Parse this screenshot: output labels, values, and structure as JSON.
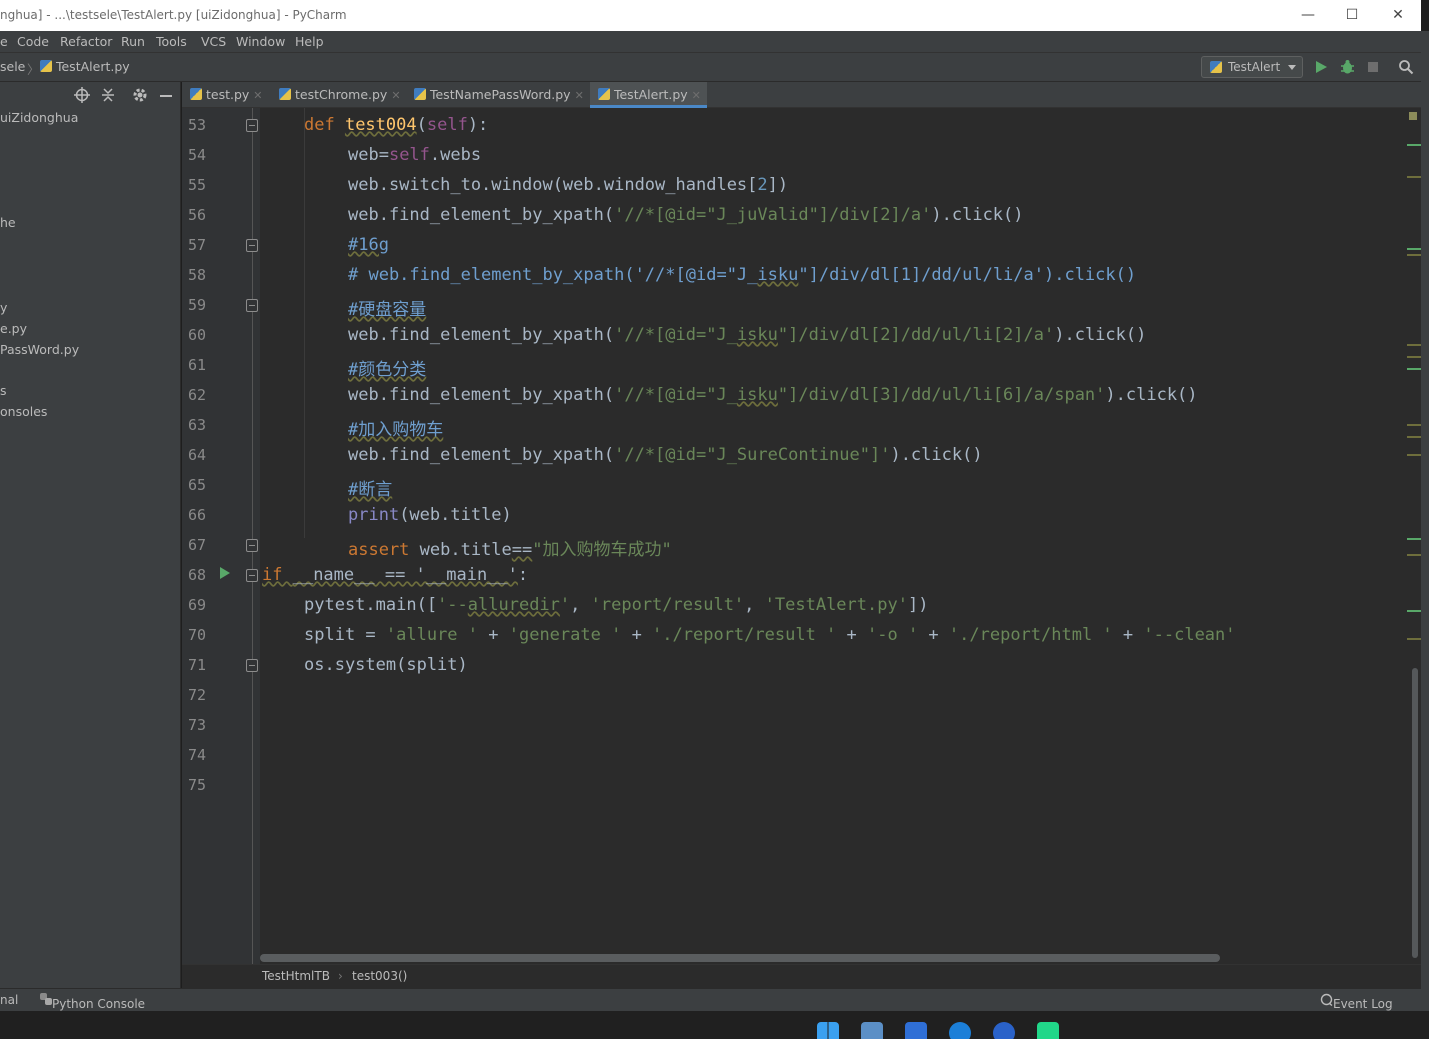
{
  "window": {
    "title": "nghua] - ...\\testsele\\TestAlert.py [uiZidonghua] - PyCharm",
    "minimize": "—",
    "maximize": "☐",
    "close": "✕"
  },
  "menu": [
    "e",
    "Code",
    "Refactor",
    "Run",
    "Tools",
    "VCS",
    "Window",
    "Help"
  ],
  "nav": {
    "crumb_folder": "sele",
    "crumb_sep": "〉",
    "crumb_file": "TestAlert.py",
    "run_config": "TestAlert"
  },
  "project_tree": [
    "uiZidonghua",
    "he",
    "y",
    "e.py",
    "PassWord.py",
    "s",
    "onsoles"
  ],
  "tabs": [
    {
      "label": "test.py",
      "active": false
    },
    {
      "label": "testChrome.py",
      "active": false
    },
    {
      "label": "TestNamePassWord.py",
      "active": false
    },
    {
      "label": "TestAlert.py",
      "active": true
    }
  ],
  "editor": {
    "line_numbers": [
      "53",
      "54",
      "55",
      "56",
      "57",
      "58",
      "59",
      "60",
      "61",
      "62",
      "63",
      "64",
      "65",
      "66",
      "67",
      "68",
      "69",
      "70",
      "71",
      "72",
      "73",
      "74",
      "75"
    ],
    "lines": [
      {
        "num": "53",
        "text": "def test004(self):"
      },
      {
        "num": "54",
        "text": "web=self.webs"
      },
      {
        "num": "55",
        "text": "web.switch_to.window(web.window_handles[2])"
      },
      {
        "num": "56",
        "text": "web.find_element_by_xpath('//*[@id=\"J_juValid\"]/div[2]/a').click()"
      },
      {
        "num": "57",
        "text": "#16g"
      },
      {
        "num": "58",
        "text": "# web.find_element_by_xpath('//*[@id=\"J_isku\"]/div/dl[1]/dd/ul/li/a').click()"
      },
      {
        "num": "59",
        "text": "#硬盘容量"
      },
      {
        "num": "60",
        "text": "web.find_element_by_xpath('//*[@id=\"J_isku\"]/div/dl[2]/dd/ul/li[2]/a').click()"
      },
      {
        "num": "61",
        "text": "#颜色分类"
      },
      {
        "num": "62",
        "text": "web.find_element_by_xpath('//*[@id=\"J_isku\"]/div/dl[3]/dd/ul/li[6]/a/span').click()"
      },
      {
        "num": "63",
        "text": "#加入购物车"
      },
      {
        "num": "64",
        "text": "web.find_element_by_xpath('//*[@id=\"J_SureContinue\"]').click()"
      },
      {
        "num": "65",
        "text": "#断言"
      },
      {
        "num": "66",
        "text": "print(web.title)"
      },
      {
        "num": "67",
        "text": "assert web.title==\"加入购物车成功\""
      },
      {
        "num": "68",
        "text": "if __name__ == '__main__':"
      },
      {
        "num": "69",
        "text": "pytest.main(['--alluredir', 'report/result', 'TestAlert.py'])"
      },
      {
        "num": "70",
        "text": "split = 'allure ' + 'generate ' + './report/result ' + '-o ' + './report/html ' + '--clean'"
      },
      {
        "num": "71",
        "text": "os.system(split)"
      }
    ]
  },
  "code_breadcrumb": {
    "class": "TestHtmlTB",
    "sep": "›",
    "method": "test003()"
  },
  "bottom": {
    "terminal": "nal",
    "python_console": "Python Console",
    "event_log": "Event Log"
  },
  "colors": {
    "keyword": "#cc7832",
    "self": "#94558d",
    "string": "#6a8759",
    "number": "#6897bb",
    "comment": "#629755",
    "accent": "#4a88c7"
  }
}
